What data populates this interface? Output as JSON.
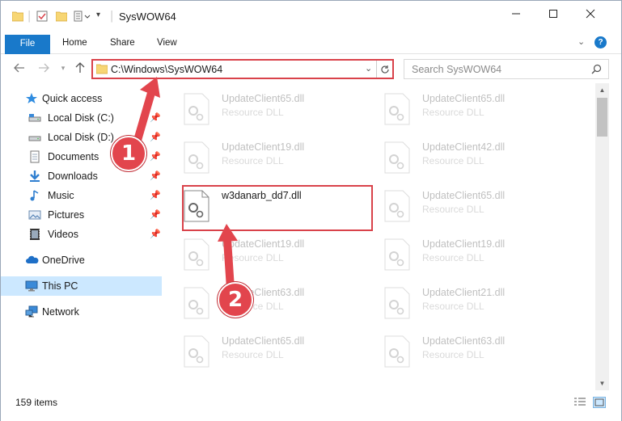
{
  "window": {
    "title": "SysWOW64",
    "controls": {
      "minimize": "—",
      "maximize": "☐",
      "close": "✕"
    }
  },
  "ribbon": {
    "tabs": [
      {
        "label": "File",
        "active": true
      },
      {
        "label": "Home"
      },
      {
        "label": "Share"
      },
      {
        "label": "View"
      }
    ]
  },
  "address": {
    "path": "C:\\Windows\\SysWOW64",
    "search_placeholder": "Search SysWOW64"
  },
  "navpane": {
    "quick_access": "Quick access",
    "pinned": [
      {
        "label": "Local Disk (C:)",
        "icon": "drive-icon"
      },
      {
        "label": "Local Disk (D:)",
        "icon": "drive-icon"
      },
      {
        "label": "Documents",
        "icon": "documents-icon"
      },
      {
        "label": "Downloads",
        "icon": "downloads-icon"
      },
      {
        "label": "Music",
        "icon": "music-icon"
      },
      {
        "label": "Pictures",
        "icon": "pictures-icon"
      },
      {
        "label": "Videos",
        "icon": "videos-icon"
      }
    ],
    "onedrive": "OneDrive",
    "this_pc": "This PC",
    "network": "Network"
  },
  "files": {
    "left": [
      {
        "name": "UpdateClient65.dll",
        "type": "Resource DLL"
      },
      {
        "name": "UpdateClient19.dll",
        "type": "Resource DLL"
      },
      {
        "name": "w3danarb_dd7.dll",
        "type": ""
      },
      {
        "name": "UpdateClient19.dll",
        "type": "Resource DLL"
      },
      {
        "name": "UpdateClient63.dll",
        "type": "Resource DLL"
      },
      {
        "name": "UpdateClient65.dll",
        "type": "Resource DLL"
      }
    ],
    "right": [
      {
        "name": "UpdateClient65.dll",
        "type": "Resource DLL"
      },
      {
        "name": "UpdateClient42.dll",
        "type": "Resource DLL"
      },
      {
        "name": "UpdateClient65.dll",
        "type": "Resource DLL"
      },
      {
        "name": "UpdateClient19.dll",
        "type": "Resource DLL"
      },
      {
        "name": "UpdateClient21.dll",
        "type": "Resource DLL"
      },
      {
        "name": "UpdateClient63.dll",
        "type": "Resource DLL"
      }
    ]
  },
  "status": {
    "count": "159 items"
  },
  "annotations": {
    "step1": "1",
    "step2": "2"
  },
  "colors": {
    "accent": "#1979ca",
    "annotation_red": "#e2454d",
    "selected": "#cce8ff"
  }
}
